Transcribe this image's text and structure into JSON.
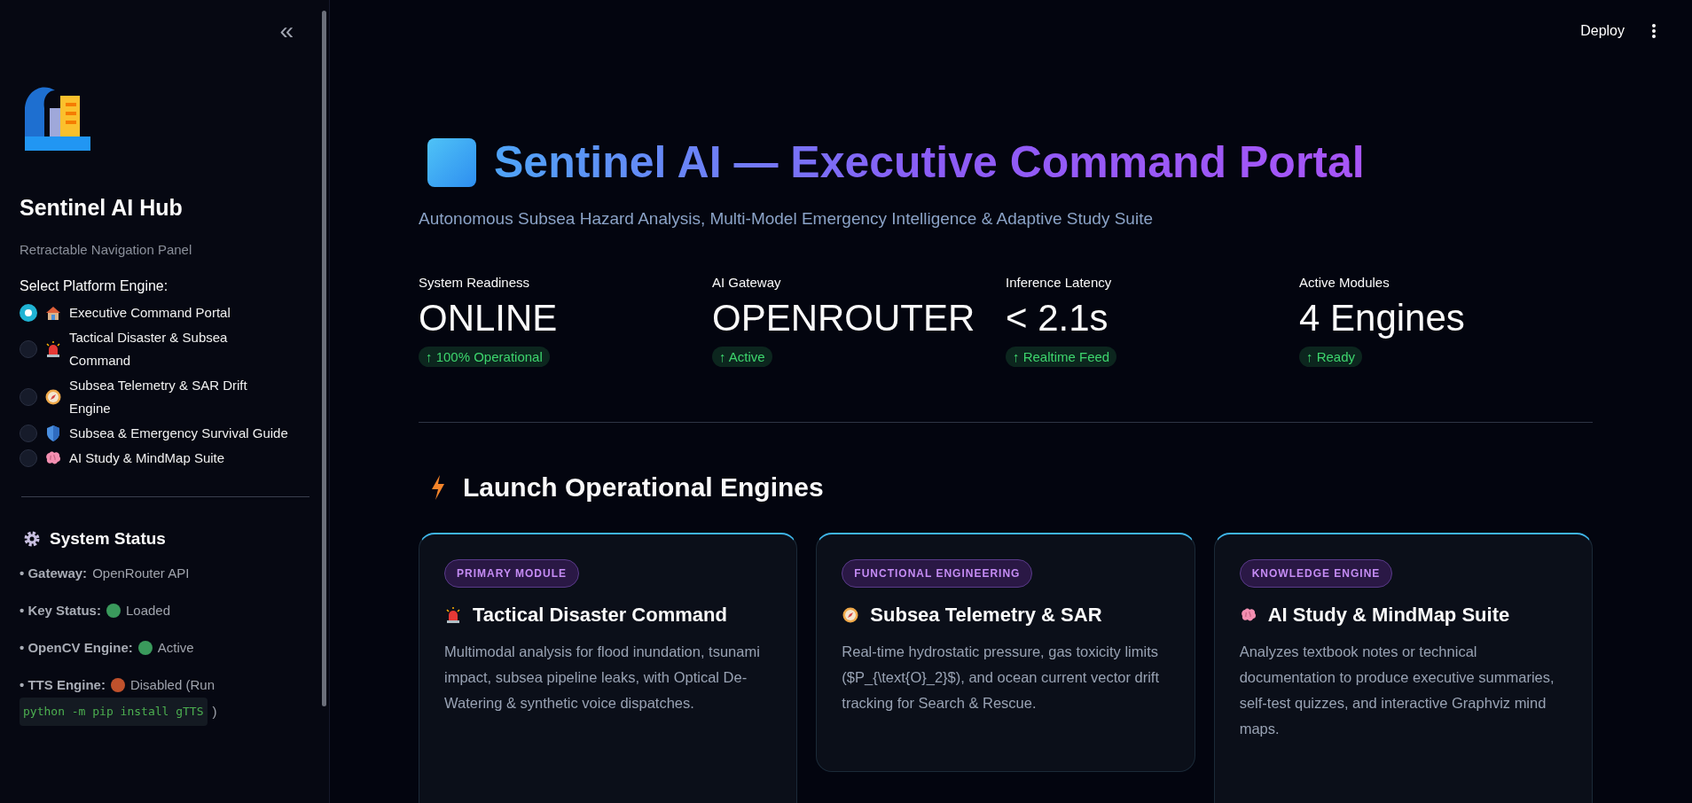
{
  "sidebar": {
    "collapse_icon": "«",
    "title": "Sentinel AI Hub",
    "subtitle": "Retractable Navigation Panel",
    "radio_label": "Select Platform Engine:",
    "engines": [
      {
        "label": "Executive Command Portal",
        "kind": "house",
        "selected": true
      },
      {
        "label": "Tactical Disaster & Subsea Command",
        "kind": "siren",
        "selected": false
      },
      {
        "label": "Subsea Telemetry & SAR Drift Engine",
        "kind": "compass",
        "selected": false
      },
      {
        "label": "Subsea & Emergency Survival Guide",
        "kind": "shield",
        "selected": false
      },
      {
        "label": "AI Study & MindMap Suite",
        "kind": "brain",
        "selected": false
      }
    ],
    "status_title": "System Status",
    "status_items": [
      {
        "label": "• Gateway:",
        "value": "OpenRouter API"
      },
      {
        "label": "• Key Status:",
        "color": "#3a9a5c",
        "value": "Loaded"
      },
      {
        "label": "• OpenCV Engine:",
        "color": "#3a9a5c",
        "value": "Active"
      },
      {
        "label": "• TTS Engine:",
        "color": "#c0512c",
        "value": "Disabled (Run",
        "code": "python -m pip install gTTS",
        "after": ")"
      }
    ]
  },
  "toolbar": {
    "deploy": "Deploy"
  },
  "header": {
    "title": "Sentinel AI — Executive Command Portal",
    "subtitle": "Autonomous Subsea Hazard Analysis, Multi-Model Emergency Intelligence & Adaptive Study Suite"
  },
  "metrics": [
    {
      "label": "System Readiness",
      "value": "ONLINE",
      "delta": "↑ 100% Operational"
    },
    {
      "label": "AI Gateway",
      "value": "OPENROUTER",
      "delta": "↑ Active"
    },
    {
      "label": "Inference Latency",
      "value": "< 2.1s",
      "delta": "↑ Realtime Feed"
    },
    {
      "label": "Active Modules",
      "value": "4 Engines",
      "delta": "↑ Ready"
    }
  ],
  "section_title": "Launch Operational Engines",
  "cards": [
    {
      "tag": "PRIMARY MODULE",
      "kind": "siren",
      "title": "Tactical Disaster Command",
      "text": "Multimodal analysis for flood inundation, tsunami impact, subsea pipeline leaks, with Optical De-Watering & synthetic voice dispatches."
    },
    {
      "tag": "FUNCTIONAL ENGINEERING",
      "kind": "compass",
      "title": "Subsea Telemetry & SAR",
      "text": "Real-time hydrostatic pressure, gas toxicity limits ($P_{\\text{O}_2}$), and ocean current vector drift tracking for Search & Rescue."
    },
    {
      "tag": "KNOWLEDGE ENGINE",
      "kind": "brain",
      "title": "AI Study & MindMap Suite",
      "text": "Analyzes textbook notes or technical documentation to produce executive summaries, self-test quizzes, and interactive Graphviz mind maps."
    }
  ]
}
